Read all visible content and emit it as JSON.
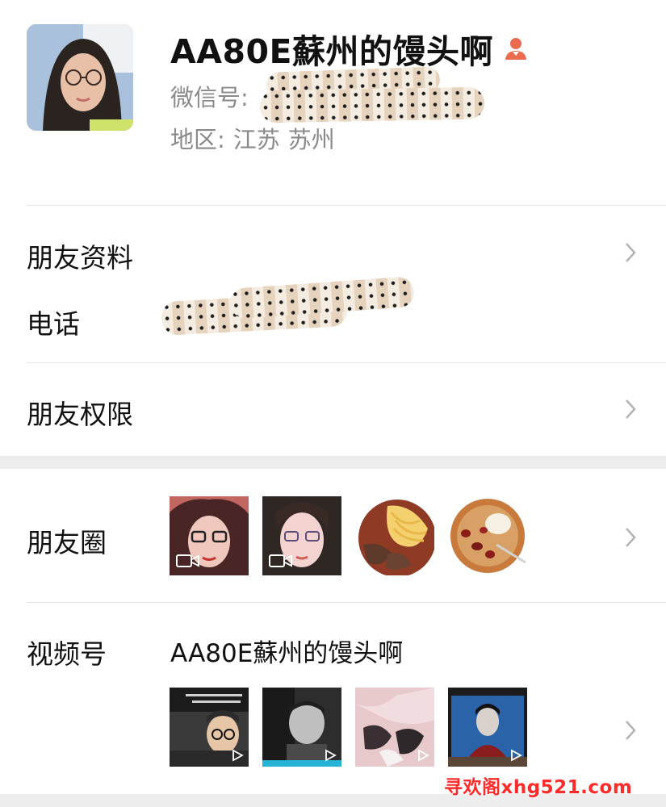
{
  "profile": {
    "display_name": "AA80E蘇州的馒头啊",
    "wechat_id_label": "微信号:",
    "region_label": "地区:",
    "region_province": "江苏",
    "region_city": "苏州",
    "gender": "female",
    "gender_icon": "female-user-icon",
    "gender_color": "#ea6b4e"
  },
  "rows": {
    "friend_info": "朋友资料",
    "phone": "电话",
    "permissions": "朋友权限",
    "moments": "朋友圈",
    "channels": "视频号"
  },
  "channels": {
    "name": "AA80E蘇州的馒头啊"
  },
  "moments_thumbs": [
    {
      "kind": "video",
      "subject": "selfie with glasses"
    },
    {
      "kind": "video",
      "subject": "selfie"
    },
    {
      "kind": "photo",
      "subject": "noodles with beef"
    },
    {
      "kind": "photo",
      "subject": "dessert soup with dates"
    }
  ],
  "channel_thumbs": [
    {
      "kind": "video"
    },
    {
      "kind": "video"
    },
    {
      "kind": "video"
    },
    {
      "kind": "video"
    }
  ],
  "watermark": "寻欢阁xhg521.com",
  "colors": {
    "chevron": "#b2b2b2",
    "secondary_text": "#8a8a8a",
    "separator": "#e5e5e5",
    "watermark": "#ff2a2a"
  }
}
